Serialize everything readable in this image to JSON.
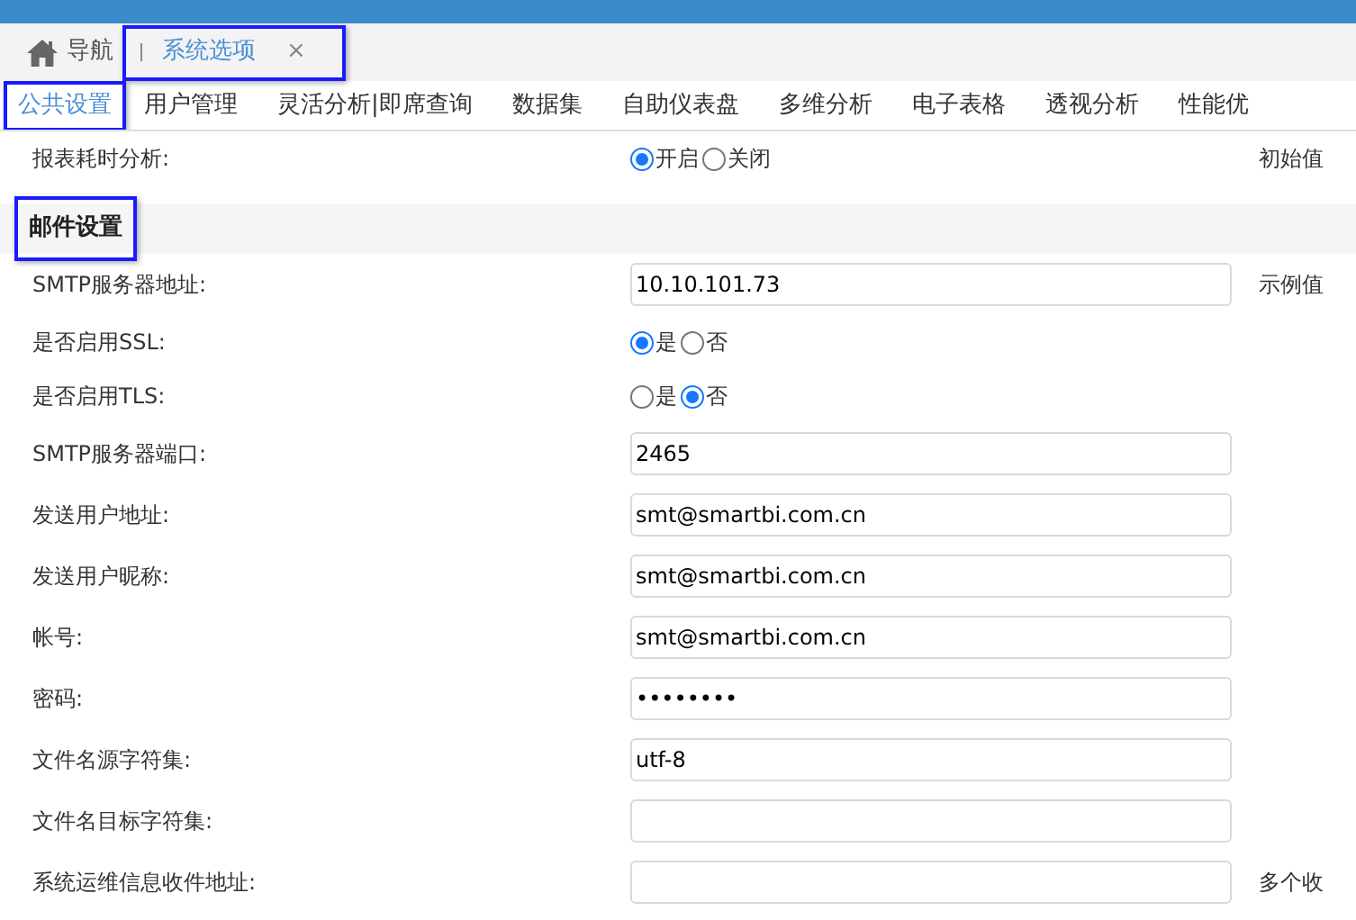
{
  "nav_tabs": [
    {
      "kind": "home",
      "label": "导航",
      "selected": false,
      "highlighted": false
    },
    {
      "kind": "page",
      "label": "系统选项",
      "close": "×",
      "selected": true,
      "highlighted": true
    }
  ],
  "sub_tabs": [
    {
      "label": "公共设置",
      "selected": true,
      "highlighted": true
    },
    {
      "label": "用户管理",
      "selected": false,
      "highlighted": false
    },
    {
      "label": "灵活分析|即席查询",
      "selected": false,
      "highlighted": false
    },
    {
      "label": "数据集",
      "selected": false,
      "highlighted": false
    },
    {
      "label": "自助仪表盘",
      "selected": false,
      "highlighted": false
    },
    {
      "label": "多维分析",
      "selected": false,
      "highlighted": false
    },
    {
      "label": "电子表格",
      "selected": false,
      "highlighted": false
    },
    {
      "label": "透视分析",
      "selected": false,
      "highlighted": false
    },
    {
      "label": "性能优",
      "selected": false,
      "highlighted": false
    }
  ],
  "top_rows": [
    {
      "kind": "radio",
      "label": "报表耗时分析:",
      "options": [
        {
          "label": "开启",
          "selected": true
        },
        {
          "label": "关闭",
          "selected": false
        }
      ],
      "note": "初始值"
    }
  ],
  "section": {
    "title": "邮件设置",
    "highlighted": true
  },
  "rows": [
    {
      "kind": "text",
      "label": "SMTP服务器地址:",
      "value": "10.10.101.73",
      "note": "示例值"
    },
    {
      "kind": "radio",
      "label": "是否启用SSL:",
      "options": [
        {
          "label": "是",
          "selected": true
        },
        {
          "label": "否",
          "selected": false
        }
      ]
    },
    {
      "kind": "radio",
      "label": "是否启用TLS:",
      "options": [
        {
          "label": "是",
          "selected": false
        },
        {
          "label": "否",
          "selected": true
        }
      ]
    },
    {
      "kind": "text",
      "label": "SMTP服务器端口:",
      "value": "2465"
    },
    {
      "kind": "text",
      "label": "发送用户地址:",
      "value": "smt@smartbi.com.cn"
    },
    {
      "kind": "text",
      "label": "发送用户昵称:",
      "value": "smt@smartbi.com.cn"
    },
    {
      "kind": "text",
      "label": "帐号:",
      "value": "smt@smartbi.com.cn"
    },
    {
      "kind": "text",
      "label": "密码:",
      "value": "••••••••"
    },
    {
      "kind": "text",
      "label": "文件名源字符集:",
      "value": "utf-8"
    },
    {
      "kind": "text",
      "label": "文件名目标字符集:",
      "value": ""
    },
    {
      "kind": "text",
      "label": "系统运维信息收件地址:",
      "value": "",
      "note": "多个收"
    }
  ]
}
